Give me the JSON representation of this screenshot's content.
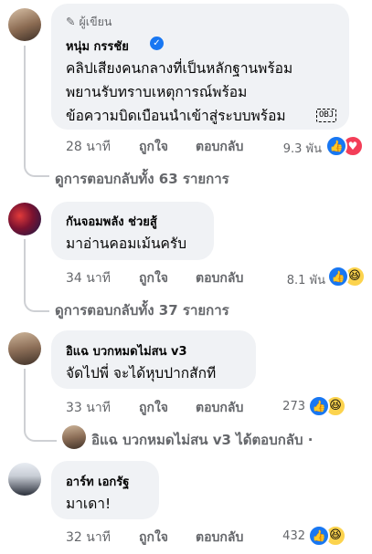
{
  "comments": [
    {
      "author_badge": "ผู้เขียน",
      "author": "หนุ่ม กรรชัย",
      "verified": true,
      "lines": [
        "คลิปเสียงคนกลางที่เป็นหลักฐานพร้อม",
        "พยานรับทราบเหตุการณ์พร้อม",
        "ข้อความบิดเบือนนำเข้าสู่ระบบพร้อม"
      ],
      "inline_emoji": "OBJ",
      "time": "28 นาที",
      "like_label": "ถูกใจ",
      "reply_label": "ตอบกลับ",
      "reaction_count": "9.3 พัน",
      "reactions": [
        "like-icon",
        "heart-icon"
      ],
      "view_replies": "ดูการตอบกลับทั้ง 63 รายการ"
    },
    {
      "author": "กันจอมพลัง ช่วยสู้",
      "lines": [
        "มาอ่านคอมเม้นครับ"
      ],
      "time": "34 นาที",
      "like_label": "ถูกใจ",
      "reply_label": "ตอบกลับ",
      "reaction_count": "8.1 พัน",
      "reactions": [
        "like-icon",
        "haha-icon"
      ],
      "view_replies": "ดูการตอบกลับทั้ง 37 รายการ"
    },
    {
      "author": "อิแฉ บวกหมดไม่สน v3",
      "lines": [
        "จัดไปพี่ จะได้หุบปากสักที"
      ],
      "time": "33 นาที",
      "like_label": "ถูกใจ",
      "reply_label": "ตอบกลับ",
      "reaction_count": "273",
      "reactions": [
        "like-icon",
        "haha-icon"
      ],
      "reply_preview": "อิแฉ บวกหมดไม่สน v3 ได้ตอบกลับ ·"
    },
    {
      "author": "อาร์ท เอกรัฐ",
      "lines": [
        "มาเดา!"
      ],
      "time": "32 นาที",
      "like_label": "ถูกใจ",
      "reply_label": "ตอบกลับ",
      "reaction_count": "432",
      "reactions": [
        "like-icon",
        "haha-icon"
      ]
    }
  ],
  "colors": {
    "bubble": "#f0f2f5",
    "meta_text": "#65676b",
    "like_blue": "#1877f2",
    "heart_red": "#f33e58",
    "haha_yellow": "#fcd34d"
  }
}
